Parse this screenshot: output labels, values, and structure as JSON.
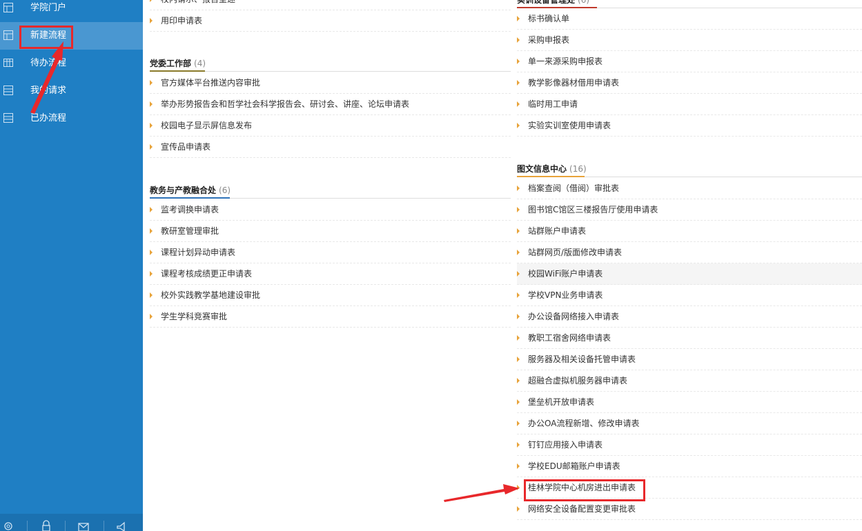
{
  "sidebar": {
    "items": [
      {
        "label": "学院门户",
        "icon": "portal-icon"
      },
      {
        "label": "新建流程",
        "icon": "layout-icon"
      },
      {
        "label": "待办流程",
        "icon": "calendar-icon"
      },
      {
        "label": "我的请求",
        "icon": "list-icon"
      },
      {
        "label": "已办流程",
        "icon": "list-icon"
      }
    ],
    "bottom_tools": [
      "gear-icon",
      "lock-icon",
      "mail-icon",
      "speaker-icon"
    ]
  },
  "left_column": {
    "top_items": [
      "校内请示、报告呈递",
      "用印申请表"
    ],
    "sections": [
      {
        "title": "党委工作部",
        "count": "(4)",
        "accent": "#8a7a2a",
        "items": [
          "官方媒体平台推送内容审批",
          "举办形势报告会和哲学社会科学报告会、研讨会、讲座、论坛申请表",
          "校园电子显示屏信息发布",
          "宣传品申请表"
        ]
      },
      {
        "title": "教务与产教融合处",
        "count": "(6)",
        "accent": "#2e72b8",
        "items": [
          "监考调换申请表",
          "教研室管理审批",
          "课程计划异动申请表",
          "课程考核成绩更正申请表",
          "校外实践教学基地建设审批",
          "学生学科竞赛审批"
        ]
      }
    ]
  },
  "right_column": {
    "partial_title": "实训设备管理处",
    "partial_count": "(6)",
    "partial_accent": "#c0392b",
    "top_items": [
      "标书确认单",
      "采购申报表",
      "单一来源采购申报表",
      "教学影像器材借用申请表",
      "临时用工申请",
      "实验实训室使用申请表"
    ],
    "section": {
      "title": "图文信息中心",
      "count": "(16)",
      "accent": "#e8a33a",
      "items": [
        "档案查阅（借阅）审批表",
        "图书馆C馆区三楼报告厅使用申请表",
        "站群账户申请表",
        "站群网页/版面修改申请表",
        "校园WiFi账户申请表",
        "学校VPN业务申请表",
        "办公设备网络接入申请表",
        "教职工宿舍网络申请表",
        "服务器及相关设备托管申请表",
        "超融合虚拟机服务器申请表",
        "堡垒机开放申请表",
        "办公OA流程新增、修改申请表",
        "钉钉应用接入申请表",
        "学校EDU邮箱账户申请表",
        "桂林学院中心机房进出申请表",
        "网络安全设备配置变更审批表"
      ]
    }
  },
  "colors": {
    "sidebar": "#1f7fc4",
    "sidebar_active": "#4a97d1",
    "bullet": "#e8a33a",
    "annotation": "#e8282b"
  }
}
